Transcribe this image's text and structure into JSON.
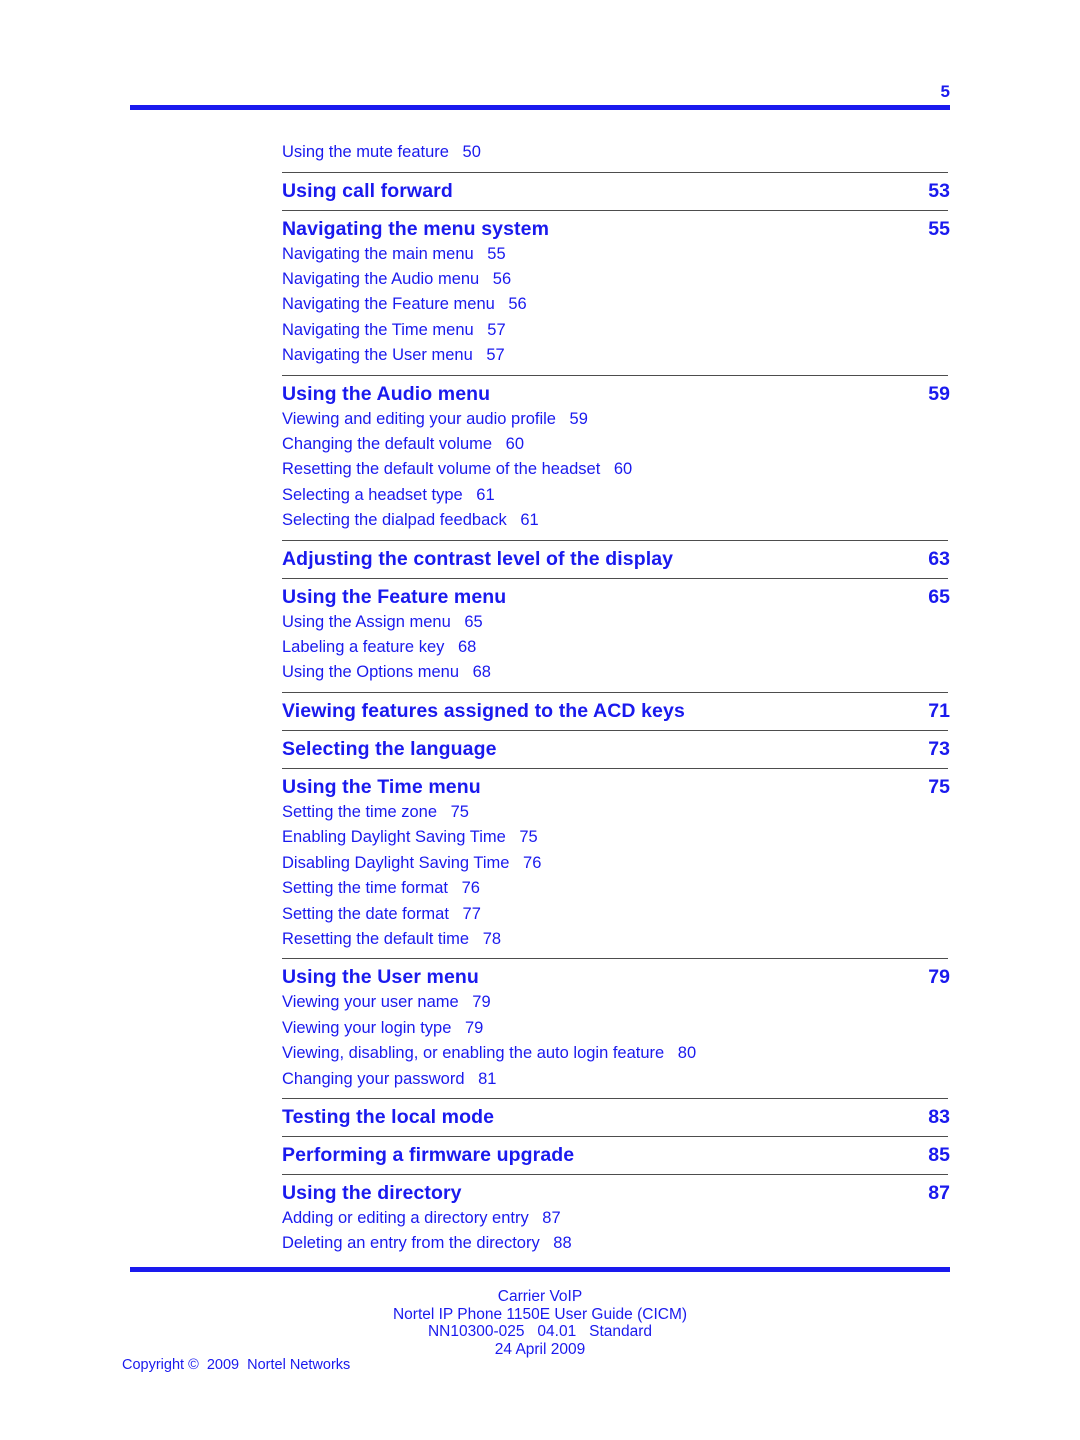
{
  "page": {
    "number": "5"
  },
  "leading_entries": [
    {
      "label": "Using the mute feature",
      "page": "50"
    }
  ],
  "sections": [
    {
      "title": "Using call forward",
      "page": "53",
      "entries": []
    },
    {
      "title": "Navigating the menu system",
      "page": "55",
      "entries": [
        {
          "label": "Navigating the main menu",
          "page": "55"
        },
        {
          "label": "Navigating the Audio menu",
          "page": "56"
        },
        {
          "label": "Navigating the Feature menu",
          "page": "56"
        },
        {
          "label": "Navigating the Time menu",
          "page": "57"
        },
        {
          "label": "Navigating the User menu",
          "page": "57"
        }
      ]
    },
    {
      "title": "Using the Audio menu",
      "page": "59",
      "entries": [
        {
          "label": "Viewing and editing your audio profile",
          "page": "59"
        },
        {
          "label": "Changing the default volume",
          "page": "60"
        },
        {
          "label": "Resetting the default volume of the headset",
          "page": "60"
        },
        {
          "label": "Selecting a headset type",
          "page": "61"
        },
        {
          "label": "Selecting the dialpad feedback",
          "page": "61"
        }
      ]
    },
    {
      "title": "Adjusting the contrast level of the display",
      "page": "63",
      "entries": []
    },
    {
      "title": "Using the Feature menu",
      "page": "65",
      "entries": [
        {
          "label": "Using the Assign menu",
          "page": "65"
        },
        {
          "label": "Labeling a feature key",
          "page": "68"
        },
        {
          "label": "Using the Options menu",
          "page": "68"
        }
      ]
    },
    {
      "title": "Viewing features assigned to the ACD keys",
      "page": "71",
      "entries": []
    },
    {
      "title": "Selecting the language",
      "page": "73",
      "entries": []
    },
    {
      "title": "Using the Time menu",
      "page": "75",
      "entries": [
        {
          "label": "Setting the time zone",
          "page": "75"
        },
        {
          "label": "Enabling Daylight Saving Time",
          "page": "75"
        },
        {
          "label": "Disabling Daylight Saving Time",
          "page": "76"
        },
        {
          "label": "Setting the time format",
          "page": "76"
        },
        {
          "label": "Setting the date format",
          "page": "77"
        },
        {
          "label": "Resetting the default time",
          "page": "78"
        }
      ]
    },
    {
      "title": "Using the User menu",
      "page": "79",
      "entries": [
        {
          "label": "Viewing your user name",
          "page": "79"
        },
        {
          "label": "Viewing your login type",
          "page": "79"
        },
        {
          "label": "Viewing, disabling, or enabling the auto login feature",
          "page": "80"
        },
        {
          "label": "Changing your password",
          "page": "81"
        }
      ]
    },
    {
      "title": "Testing the local mode",
      "page": "83",
      "entries": []
    },
    {
      "title": "Performing a firmware upgrade",
      "page": "85",
      "entries": []
    },
    {
      "title": "Using the directory",
      "page": "87",
      "entries": [
        {
          "label": "Adding or editing a directory entry",
          "page": "87"
        },
        {
          "label": "Deleting an entry from the directory",
          "page": "88"
        }
      ]
    }
  ],
  "footer": {
    "lines": [
      "Carrier VoIP",
      "Nortel IP Phone 1150E User Guide (CICM)",
      "NN10300-025   04.01   Standard",
      "24 April 2009"
    ],
    "copyright": "Copyright ©  2009  Nortel Networks"
  },
  "colors": {
    "brand_blue": "#1a1aee",
    "rule_gray": "#4d4d4d",
    "background": "#ffffff"
  }
}
